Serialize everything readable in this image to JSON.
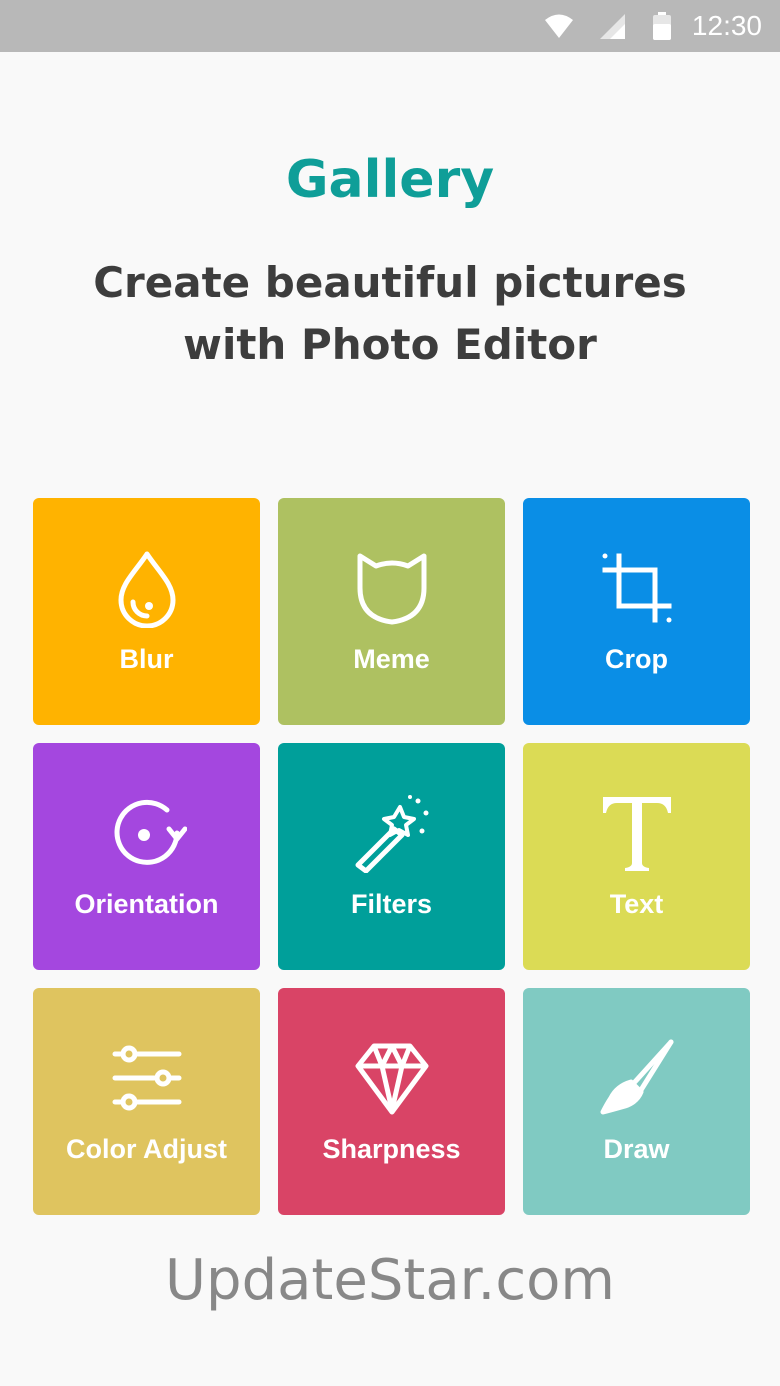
{
  "status_bar": {
    "time": "12:30",
    "icons": [
      "wifi-icon",
      "signal-icon",
      "battery-icon"
    ]
  },
  "header": {
    "title": "Gallery",
    "subtitle": "Create beautiful pictures with Photo Editor"
  },
  "tools": [
    {
      "label": "Blur",
      "icon": "droplet-icon",
      "color": "#ffb300"
    },
    {
      "label": "Meme",
      "icon": "cat-face-icon",
      "color": "#aec161"
    },
    {
      "label": "Crop",
      "icon": "crop-icon",
      "color": "#0a8ee6"
    },
    {
      "label": "Orientation",
      "icon": "rotate-icon",
      "color": "#a447df"
    },
    {
      "label": "Filters",
      "icon": "magic-wand-icon",
      "color": "#009f9a"
    },
    {
      "label": "Text",
      "icon": "text-t-icon",
      "color": "#dbdb55"
    },
    {
      "label": "Color Adjust",
      "icon": "sliders-icon",
      "color": "#dfc45f"
    },
    {
      "label": "Sharpness",
      "icon": "diamond-icon",
      "color": "#d94466"
    },
    {
      "label": "Draw",
      "icon": "brush-icon",
      "color": "#80cac2"
    }
  ],
  "watermark": "UpdateStar.com"
}
